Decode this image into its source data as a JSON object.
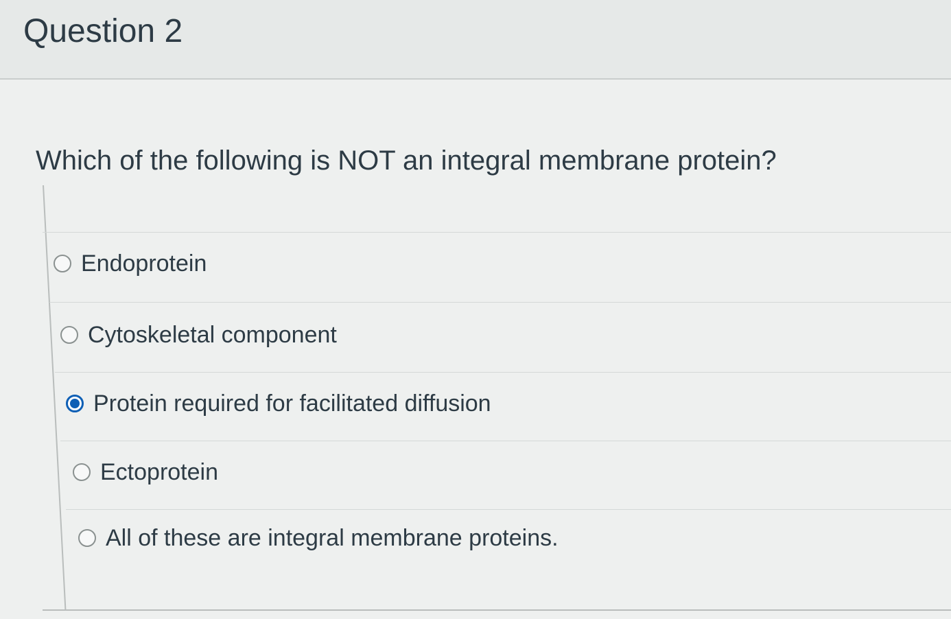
{
  "question": {
    "title": "Question 2",
    "text": "Which of the following is NOT an integral membrane protein?",
    "answers": [
      {
        "label": "Endoprotein",
        "selected": false
      },
      {
        "label": "Cytoskeletal component",
        "selected": false
      },
      {
        "label": "Protein required for facilitated diffusion",
        "selected": true
      },
      {
        "label": "Ectoprotein",
        "selected": false
      },
      {
        "label": "All of these are integral membrane proteins.",
        "selected": false
      }
    ]
  },
  "colors": {
    "accent": "#0e5fb5",
    "text": "#2d3b45",
    "background": "#eef0ef"
  }
}
